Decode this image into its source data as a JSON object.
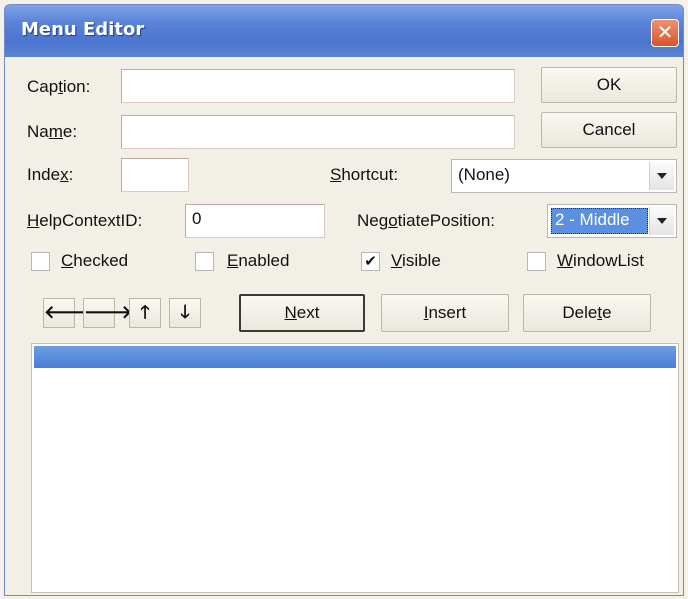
{
  "window": {
    "title": "Menu Editor",
    "close_glyph": "✕"
  },
  "form": {
    "caption_label": "Caption:",
    "caption_value": "",
    "name_label": "Name:",
    "name_value": "",
    "index_label": "Index:",
    "index_value": "",
    "shortcut_label": "Shortcut:",
    "shortcut_value": "(None)",
    "helpcontext_label": "HelpContextID:",
    "helpcontext_value": "0",
    "negotiate_label": "NegotiatePosition:",
    "negotiate_value": "2 - Middle"
  },
  "buttons": {
    "ok": "OK",
    "cancel": "Cancel",
    "next": "Next",
    "insert": "Insert",
    "delete": "Delete"
  },
  "checkboxes": [
    {
      "label": "Checked",
      "checked": false
    },
    {
      "label": "Enabled",
      "checked": false
    },
    {
      "label": "Visible",
      "checked": true
    },
    {
      "label": "WindowList",
      "checked": false
    }
  ],
  "arrows": {
    "left": "🡐",
    "right": "🡒",
    "up": "🡑",
    "down": "🡓"
  },
  "colors": {
    "titlebar": "#4a75cf",
    "selection": "#5b8fe0",
    "close_button": "#d9542a"
  }
}
